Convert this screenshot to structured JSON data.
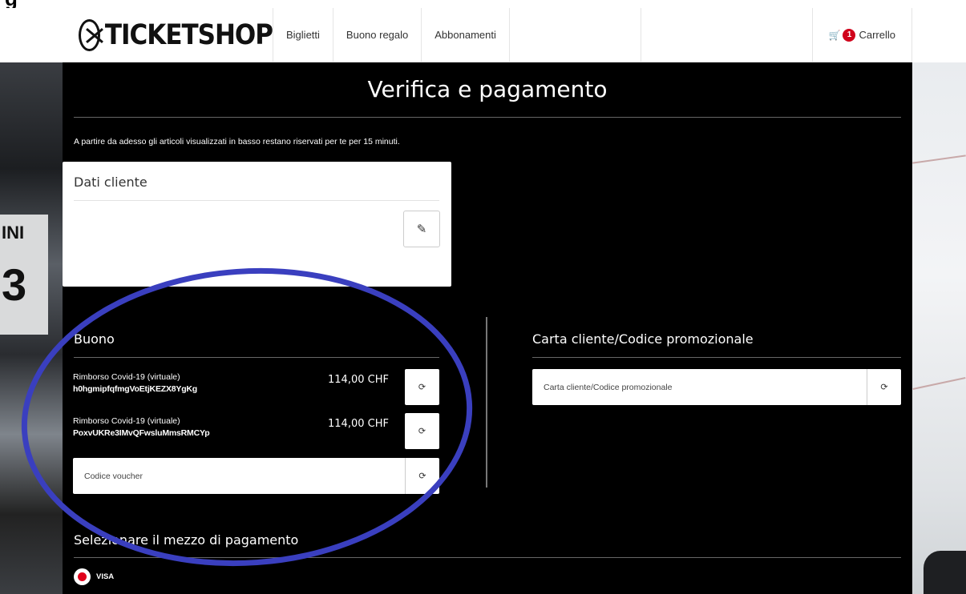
{
  "header": {
    "logo_text": "TICKETSHOP",
    "nav": [
      "Biglietti",
      "Buono regalo",
      "Abbonamenti"
    ],
    "cart_count": "1",
    "cart_label": "Carrello"
  },
  "page": {
    "title": "Verifica e pagamento",
    "notice": "A partire da adesso gli articoli visualizzati in basso restano riservati per te per 15 minuti."
  },
  "customer": {
    "title": "Dati cliente"
  },
  "voucher": {
    "title": "Buono",
    "items": [
      {
        "label": "Rimborso Covid-19 (virtuale)",
        "code": "h0hgmipfqfmgVoEtjKEZX8YgKg",
        "amount": "114,00 CHF"
      },
      {
        "label": "Rimborso Covid-19 (virtuale)",
        "code": "PoxvUKRe3IMvQFwsluMmsRMCYp",
        "amount": "114,00 CHF"
      }
    ],
    "input_placeholder": "Codice voucher"
  },
  "promo": {
    "title": "Carta cliente/Codice promozionale",
    "input_placeholder": "Carta cliente/Codice promozionale"
  },
  "payment": {
    "title": "Selezionare il mezzo di pagamento",
    "options": [
      "VISA"
    ]
  },
  "colors": {
    "panel": "#000000",
    "badge": "#d0021b",
    "annotation": "#3a3fbf",
    "radio": "#e0001b"
  }
}
